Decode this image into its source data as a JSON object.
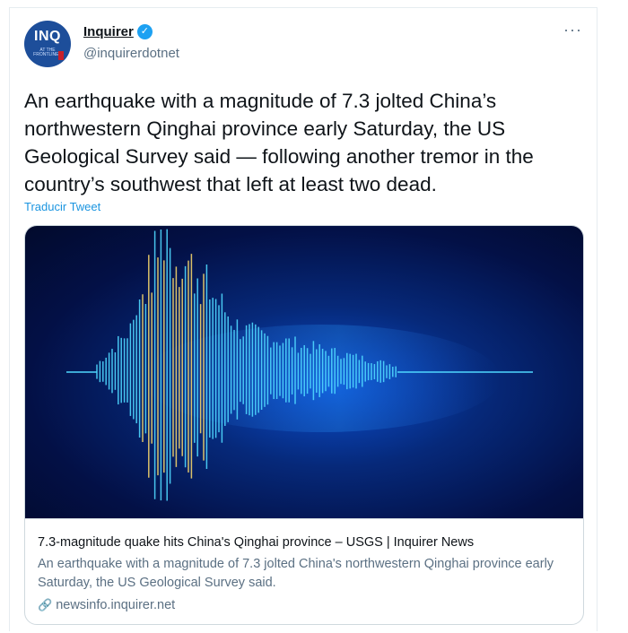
{
  "author": {
    "name": "Inquirer",
    "handle": "@inquirerdotnet",
    "avatar_text": "INQ",
    "avatar_subtext": "AT THE FRONTLINES",
    "verified": true
  },
  "tweet": {
    "text": "An earthquake with a magnitude of 7.3 jolted China’s northwestern Qinghai province early Saturday, the US Geological Survey said — following another tremor in the country’s southwest that left at least two dead.",
    "translate_label": "Traducir Tweet"
  },
  "card": {
    "title": "7.3-magnitude quake hits China's Qinghai province – USGS | Inquirer News",
    "description": "An earthquake with a magnitude of 7.3 jolted China's northwestern Qinghai province early Saturday, the US Geological Survey said.",
    "domain": "newsinfo.inquirer.net",
    "image_icon": "seismograph-waveform"
  },
  "icons": {
    "more": "more-options-icon",
    "verified": "verified-badge-icon",
    "link": "link-icon"
  },
  "colors": {
    "accent": "#1da1f2",
    "link": "#1b95e0",
    "secondary_text": "#5b7083",
    "wave_cyan": "#4fd8ff",
    "wave_yellow": "#f2d36b",
    "image_bg": "#06297a"
  }
}
